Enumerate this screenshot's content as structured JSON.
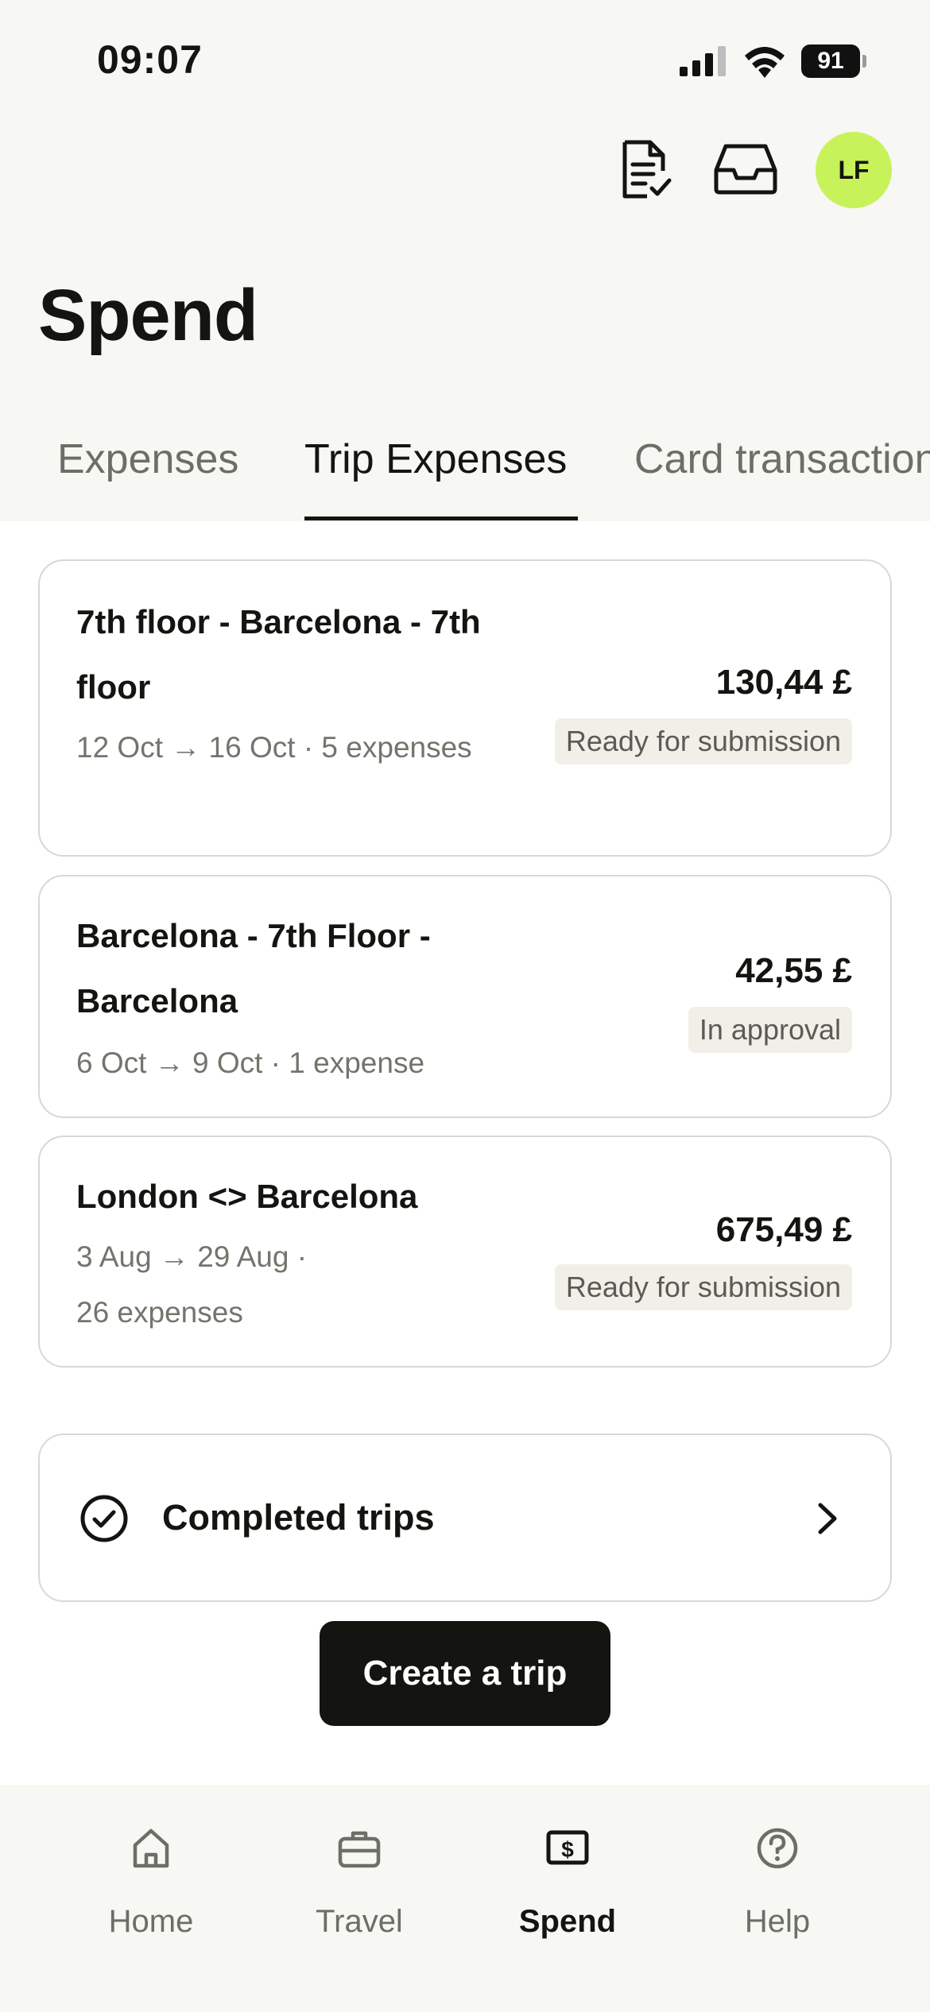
{
  "status_bar": {
    "time": "09:07",
    "battery": "91"
  },
  "header": {
    "avatar_initials": "LF",
    "title": "Spend"
  },
  "tabs": [
    {
      "label": "Expenses"
    },
    {
      "label": "Trip Expenses"
    },
    {
      "label": "Card transactions"
    }
  ],
  "trips": [
    {
      "name": "7th floor - Barcelona - 7th floor",
      "meta": "12 Oct → 16 Oct · 5 expenses",
      "amount": "130,44 £",
      "status": "Ready for submission"
    },
    {
      "name": "Barcelona - 7th Floor - Barcelona",
      "meta": "6 Oct → 9 Oct · 1 expense",
      "amount": "42,55 £",
      "status": "In approval"
    },
    {
      "name": "London <> Barcelona",
      "meta": "3 Aug → 29 Aug · 26 expenses",
      "amount": "675,49 £",
      "status": "Ready for submission"
    }
  ],
  "completed_trips": {
    "label": "Completed trips"
  },
  "create_trip": {
    "label": "Create a trip"
  },
  "bottom_nav": [
    {
      "label": "Home",
      "icon": "home-icon"
    },
    {
      "label": "Travel",
      "icon": "briefcase-icon"
    },
    {
      "label": "Spend",
      "icon": "dollar-icon"
    },
    {
      "label": "Help",
      "icon": "help-icon"
    }
  ],
  "colors": {
    "accent_avatar": "#c8f25a",
    "primary": "#141410",
    "badge_bg": "#f1f0e8"
  }
}
